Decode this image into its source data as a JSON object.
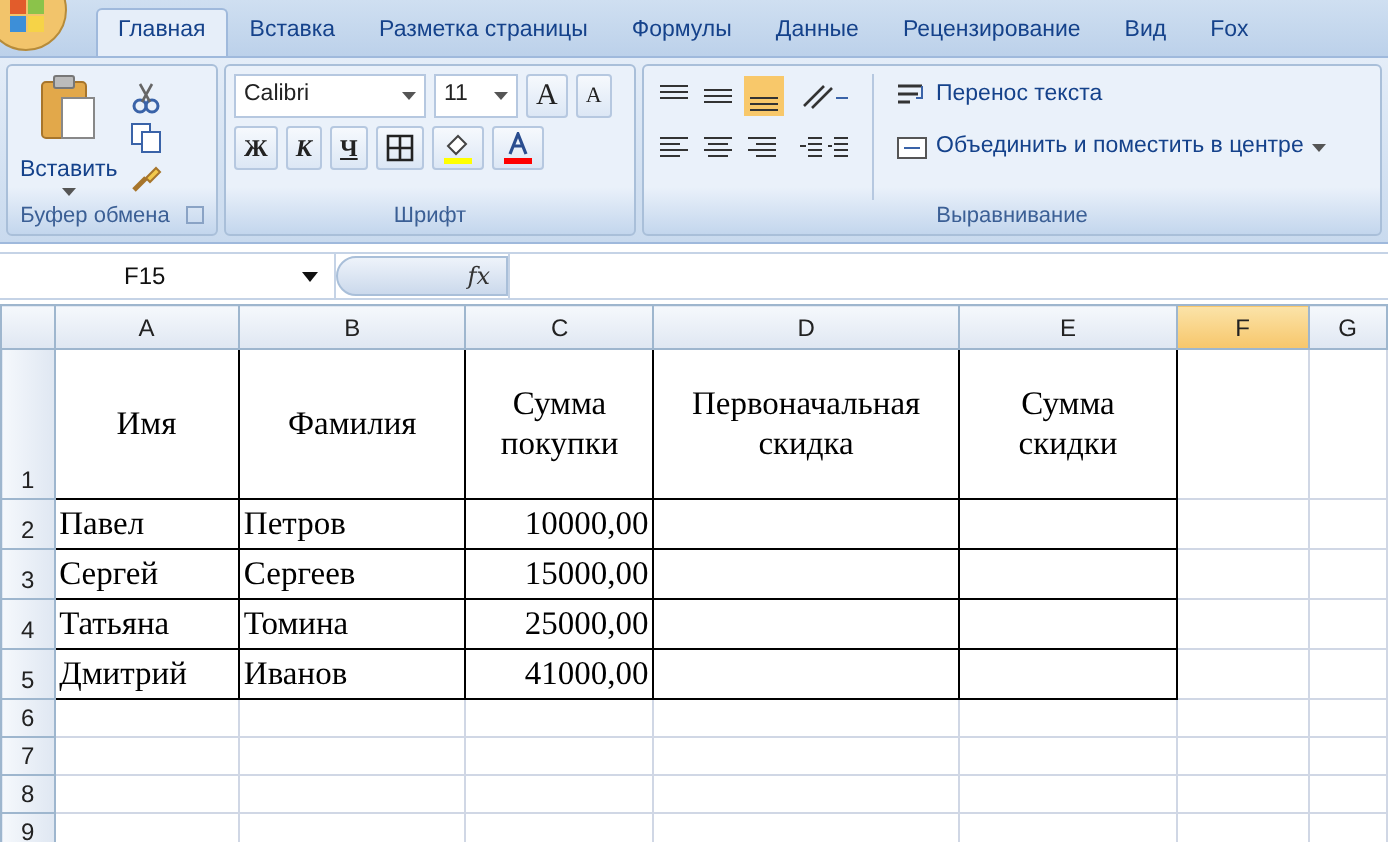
{
  "tabs": [
    {
      "label": "Главная",
      "selected": true
    },
    {
      "label": "Вставка",
      "selected": false
    },
    {
      "label": "Разметка страницы",
      "selected": false
    },
    {
      "label": "Формулы",
      "selected": false
    },
    {
      "label": "Данные",
      "selected": false
    },
    {
      "label": "Рецензирование",
      "selected": false
    },
    {
      "label": "Вид",
      "selected": false
    },
    {
      "label": "Fox",
      "selected": false
    }
  ],
  "clipboard": {
    "paste_label": "Вставить",
    "title": "Буфер обмена"
  },
  "font": {
    "name": "Calibri",
    "size": "11",
    "bold": "Ж",
    "italic": "К",
    "underline": "Ч",
    "grow": "A",
    "shrink": "A",
    "title": "Шрифт"
  },
  "alignment": {
    "wrap_text": "Перенос текста",
    "merge": "Объединить и поместить в центре",
    "title": "Выравнивание"
  },
  "formula_bar": {
    "name_box": "F15",
    "fx": "fx"
  },
  "columns": [
    {
      "label": "A",
      "selected": false
    },
    {
      "label": "B",
      "selected": false
    },
    {
      "label": "C",
      "selected": false
    },
    {
      "label": "D",
      "selected": false
    },
    {
      "label": "E",
      "selected": false
    },
    {
      "label": "F",
      "selected": true
    },
    {
      "label": "G",
      "selected": false
    }
  ],
  "rows": [
    {
      "number": "1",
      "kind": "header",
      "cells": [
        "Имя",
        "Фамилия",
        "Сумма покупки",
        "Первоначальная скидка",
        "Сумма скидки"
      ]
    },
    {
      "number": "2",
      "kind": "data",
      "cells": [
        "Павел",
        "Петров",
        "10000,00",
        "",
        ""
      ]
    },
    {
      "number": "3",
      "kind": "data",
      "cells": [
        "Сергей",
        "Сергеев",
        "15000,00",
        "",
        ""
      ]
    },
    {
      "number": "4",
      "kind": "data",
      "cells": [
        "Татьяна",
        "Томина",
        "25000,00",
        "",
        ""
      ]
    },
    {
      "number": "5",
      "kind": "data",
      "cells": [
        "Дмитрий",
        "Иванов",
        "41000,00",
        "",
        ""
      ]
    },
    {
      "number": "6",
      "kind": "empty",
      "cells": []
    },
    {
      "number": "7",
      "kind": "empty",
      "cells": []
    },
    {
      "number": "8",
      "kind": "empty",
      "cells": []
    },
    {
      "number": "9",
      "kind": "empty",
      "cells": []
    }
  ]
}
